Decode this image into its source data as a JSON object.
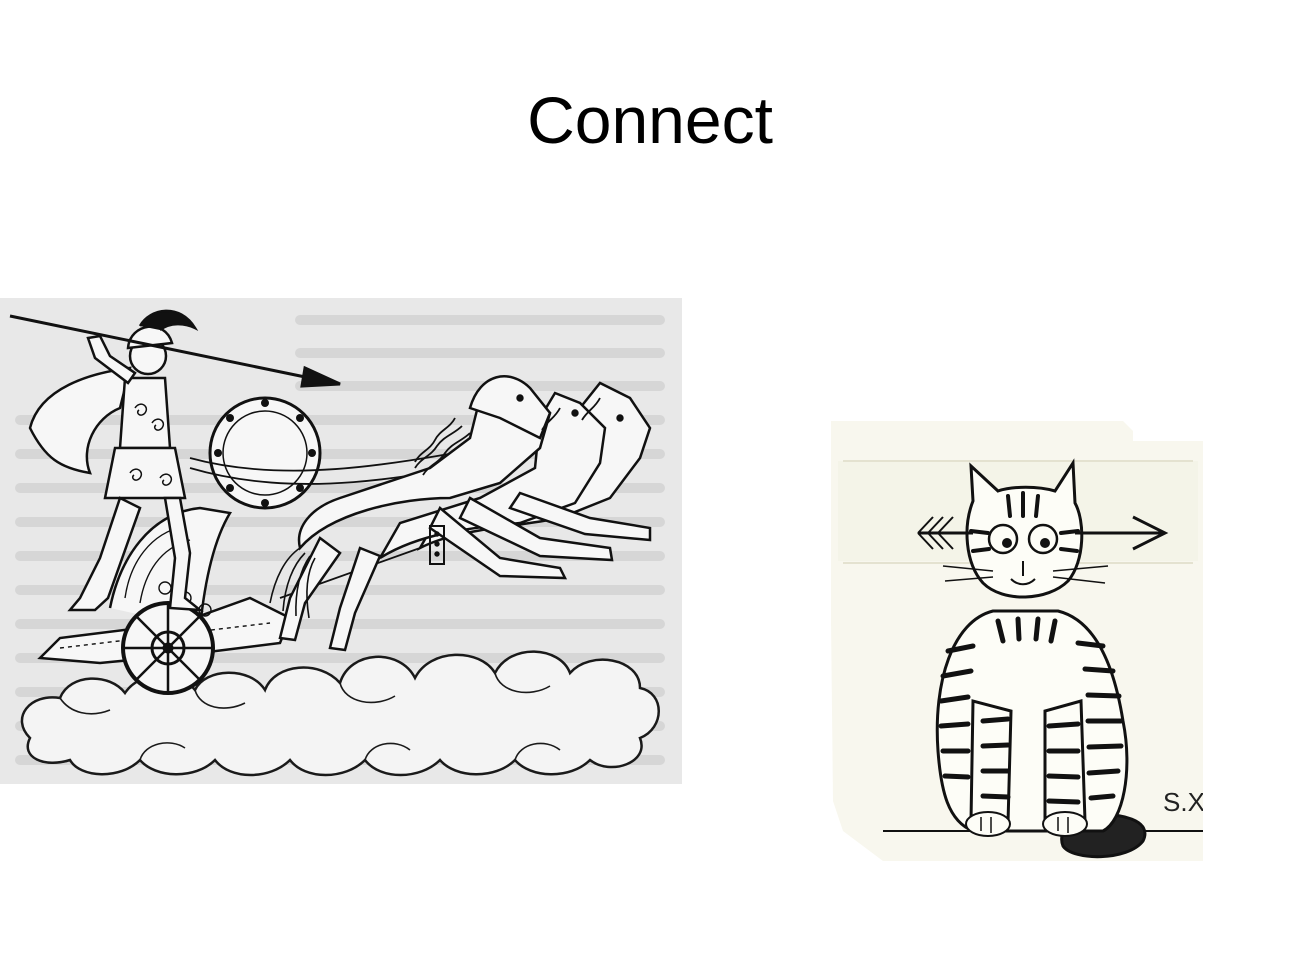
{
  "slide": {
    "title": "Connect"
  },
  "images": {
    "left": {
      "icon": "chariot-warrior-illustration"
    },
    "right": {
      "icon": "cat-with-arrow-illustration",
      "signature": "S.X"
    }
  },
  "colors": {
    "background": "#ffffff",
    "text": "#000000",
    "left_paper": "#e9e9e9",
    "right_paper": "#f8f7ee"
  }
}
